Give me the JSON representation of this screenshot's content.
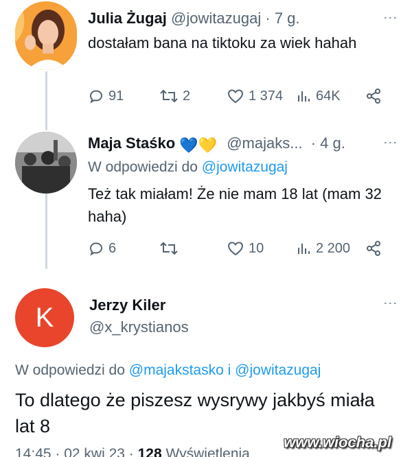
{
  "tweet1": {
    "name": "Julia Żugaj",
    "handle": "@jowitazugaj",
    "separator": "·",
    "time": "7 g.",
    "text": "dostałam bana na tiktoku za wiek hahah",
    "replies": "91",
    "retweets": "2",
    "likes": "1 374",
    "views": "64K"
  },
  "tweet2": {
    "name": "Maja Staśko",
    "hearts": "💙💛",
    "handle": "@majaks...",
    "separator": "·",
    "time": "4 g.",
    "reply_prefix": "W odpowiedzi do",
    "reply_mention": "@jowitazugaj",
    "text": "Też tak miałam! Że nie mam 18 lat (mam 32 haha)",
    "replies": "6",
    "retweets": "",
    "likes": "10",
    "views": "2 200"
  },
  "tweet3": {
    "avatar_letter": "K",
    "name": "Jerzy Kiler",
    "handle": "@x_krystianos",
    "reply_prefix": "W odpowiedzi do",
    "reply_mention1": "@majakstasko",
    "reply_and": "i",
    "reply_mention2": "@jowitazugaj",
    "text": "To dlatego że piszesz wysrywy jakbyś miała lat 8",
    "footer_time": "14:45 · 02 kwi 23 ·",
    "footer_views_count": "128",
    "footer_views_label": "Wyświetlenia"
  },
  "watermark": "www.wiocha.pl",
  "colors": {
    "accent": "#1d9bf0",
    "secondary_text": "#536471",
    "thread_line": "#cfd9de",
    "avatar_k": "#e8452c"
  }
}
